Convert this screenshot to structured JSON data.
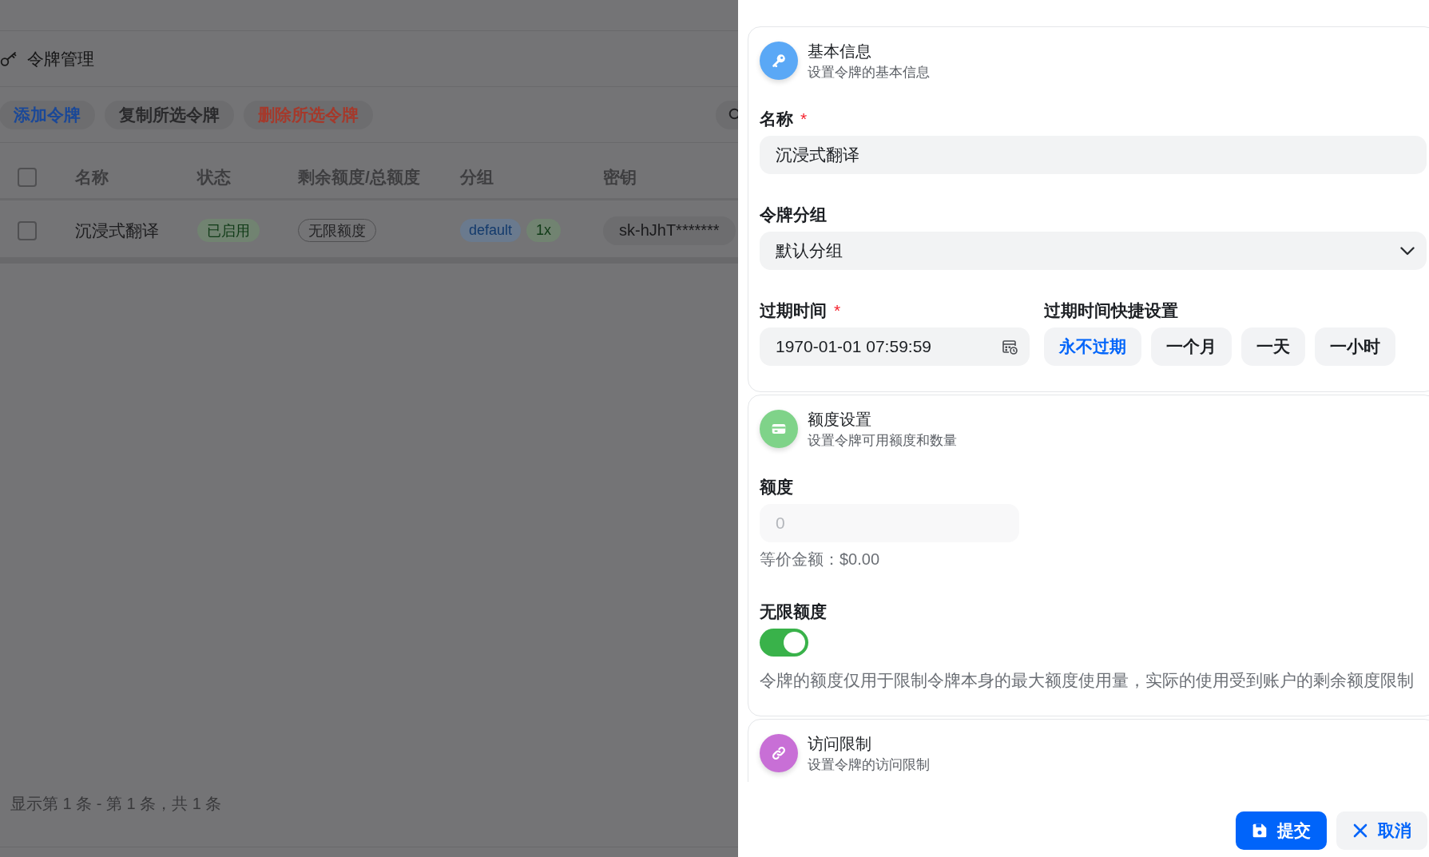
{
  "page": {
    "title": "令牌管理",
    "toolbar": [
      {
        "label": "添加令牌",
        "kind": "primary"
      },
      {
        "label": "复制所选令牌",
        "kind": "default"
      },
      {
        "label": "删除所选令牌",
        "kind": "danger"
      }
    ],
    "table": {
      "all_selected": false,
      "columns": [
        "名称",
        "状态",
        "剩余额度/总额度",
        "分组",
        "密钥"
      ],
      "rows": [
        {
          "selected": false,
          "name": "沉浸式翻译",
          "status": "已启用",
          "quota": "无限额度",
          "group": "default",
          "ratio": "1x",
          "key": "sk-hJhT*******"
        }
      ]
    },
    "pagination": "显示第 1 条 - 第 1 条，共 1 条"
  },
  "drawer": {
    "sections": [
      {
        "kind": "basic",
        "color": "#5aa8f6",
        "title": "基本信息",
        "subtitle": "设置令牌的基本信息",
        "rows": [
          {
            "fields": [
              {
                "kind": "text",
                "label": "名称",
                "required_mark": "*",
                "value": "沉浸式翻译"
              }
            ]
          },
          {
            "fields": [
              {
                "kind": "select",
                "label": "令牌分组",
                "value": "默认分组"
              }
            ]
          },
          {
            "fields": [
              {
                "kind": "datetime",
                "label": "过期时间",
                "required_mark": "*",
                "value": "1970-01-01 07:59:59"
              },
              {
                "kind": "choices",
                "label": "过期时间快捷设置",
                "options": [
                  {
                    "label": "永不过期",
                    "selected": true
                  },
                  {
                    "label": "一个月",
                    "selected": false
                  },
                  {
                    "label": "一天",
                    "selected": false
                  },
                  {
                    "label": "一小时",
                    "selected": false
                  }
                ]
              }
            ]
          }
        ]
      },
      {
        "kind": "quota",
        "color": "#7fd389",
        "title": "额度设置",
        "subtitle": "设置令牌可用额度和数量",
        "rows": [
          {
            "fields": [
              {
                "kind": "number",
                "label": "额度",
                "placeholder": "0",
                "disabled": true,
                "note": "等价金额：$0.00"
              }
            ]
          },
          {
            "fields": [
              {
                "kind": "switch",
                "label": "无限额度",
                "on": true,
                "help": "令牌的额度仅用于限制令牌本身的最大额度使用量，实际的使用受到账户的剩余额度限制"
              }
            ]
          }
        ]
      },
      {
        "kind": "access",
        "color": "#c86fd6",
        "title": "访问限制",
        "subtitle": "设置令牌的访问限制"
      }
    ],
    "buttons": [
      {
        "label": "提交",
        "kind": "primary"
      },
      {
        "label": "取消",
        "kind": "secondary"
      }
    ]
  }
}
